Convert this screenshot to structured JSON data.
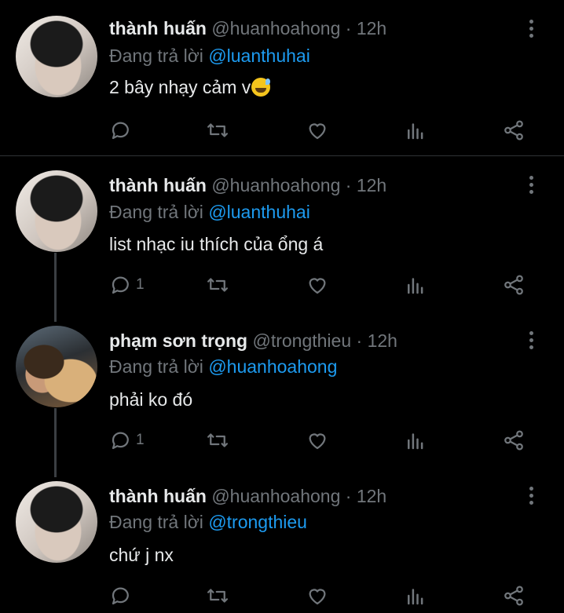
{
  "tweets": [
    {
      "name": "thành huấn",
      "handle": "@huanhoahong",
      "time": "12h",
      "reply_prefix": "Đang trả lời",
      "reply_to": "@luanthuhai",
      "text": "2 bây nhạy cảm v",
      "emoji": "sweat-smile",
      "reply_count": ""
    },
    {
      "name": "thành huấn",
      "handle": "@huanhoahong",
      "time": "12h",
      "reply_prefix": "Đang trả lời",
      "reply_to": "@luanthuhai",
      "text": "list nhạc iu thích của ổng á",
      "reply_count": "1"
    },
    {
      "name": "phạm sơn trọng",
      "handle": "@trongthieu",
      "time": "12h",
      "reply_prefix": "Đang trả lời",
      "reply_to": "@huanhoahong",
      "text": "phải ko đó",
      "reply_count": "1"
    },
    {
      "name": "thành huấn",
      "handle": "@huanhoahong",
      "time": "12h",
      "reply_prefix": "Đang trả lời",
      "reply_to": "@trongthieu",
      "text": "chứ j nx",
      "reply_count": ""
    }
  ],
  "separator": "·",
  "colors": {
    "background": "#000000",
    "text": "#e7e9ea",
    "muted": "#71767b",
    "accent": "#1d9bf0"
  },
  "icons": [
    "reply-icon",
    "retweet-icon",
    "like-icon",
    "views-icon",
    "share-icon",
    "more-options-icon"
  ]
}
